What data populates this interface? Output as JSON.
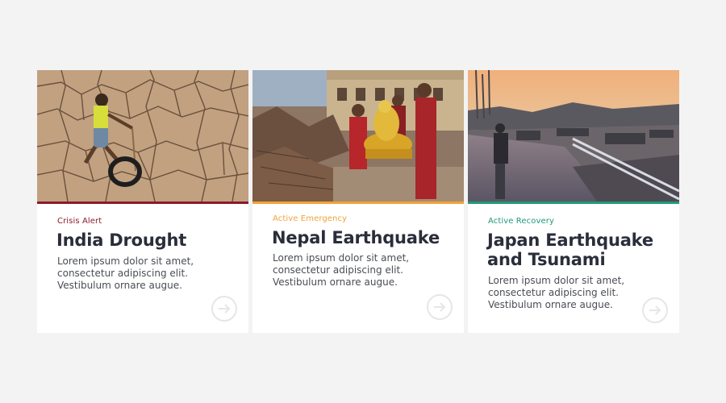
{
  "cards": [
    {
      "category": "Crisis Alert",
      "title": "India Drought",
      "description": "Lorem ipsum dolor sit amet, consectetur adipiscing elit. Vestibulum ornare augue.",
      "accent": "#8b1a2b",
      "photo": "cracked-dry-earth-child-with-tire"
    },
    {
      "category": "Active Emergency",
      "title": "Nepal Earthquake",
      "description": "Lorem ipsum dolor sit amet, consectetur adipiscing elit. Vestibulum ornare augue.",
      "accent": "#f2a23a",
      "photo": "monks-carrying-golden-statue-in-rubble"
    },
    {
      "category": "Active Recovery",
      "title": "Japan Earthquake and Tsunami",
      "description": "Lorem ipsum dolor sit amet, consectetur adipiscing elit. Vestibulum ornare augue.",
      "accent": "#1f9a7a",
      "photo": "flooded-town-debris-at-sunset"
    }
  ],
  "colors": {
    "background": "#f3f3f3",
    "card": "#ffffff",
    "title": "#2a2e3a",
    "body_text": "#4a4d55",
    "arrow": "#e6e6e6"
  }
}
